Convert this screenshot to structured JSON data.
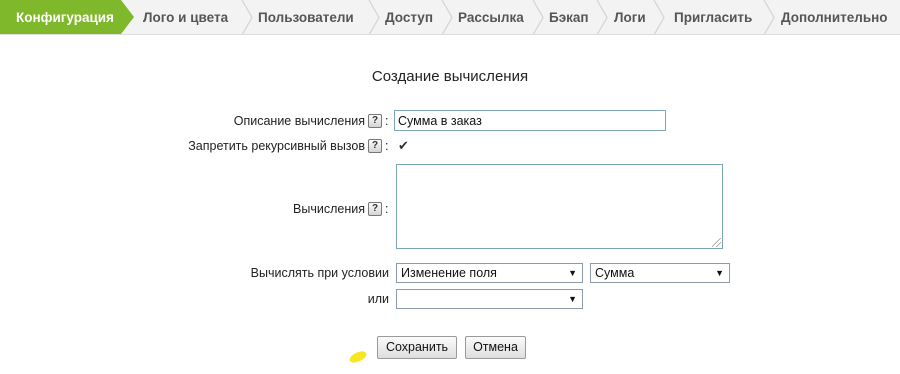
{
  "wizard": {
    "steps": [
      {
        "label": "Конфигурация",
        "active": true
      },
      {
        "label": "Лого и цвета"
      },
      {
        "label": "Пользователи"
      },
      {
        "label": "Доступ"
      },
      {
        "label": "Рассылка"
      },
      {
        "label": "Бэкап"
      },
      {
        "label": "Логи"
      },
      {
        "label": "Пригласить"
      },
      {
        "label": "Дополнительно"
      }
    ],
    "active_color": "#7fb82a"
  },
  "form": {
    "title": "Создание вычисления",
    "description": {
      "label": "Описание вычисления",
      "value": "Сумма в заказ",
      "help_icon": "question-icon"
    },
    "no_recursive": {
      "label": "Запретить рекурсивный вызов",
      "checked": true,
      "help_icon": "question-icon"
    },
    "calculations": {
      "label": "Вычисления",
      "value": "",
      "help_icon": "question-icon"
    },
    "condition": {
      "label": "Вычислять при условии",
      "select1": "Изменение поля",
      "select2": "Сумма"
    },
    "or_condition": {
      "label": "или",
      "select": ""
    },
    "help_glyph": "?",
    "colon": ":",
    "checkmark": "✔",
    "arrow": "▼"
  },
  "buttons": {
    "save": "Сохранить",
    "cancel": "Отмена"
  }
}
